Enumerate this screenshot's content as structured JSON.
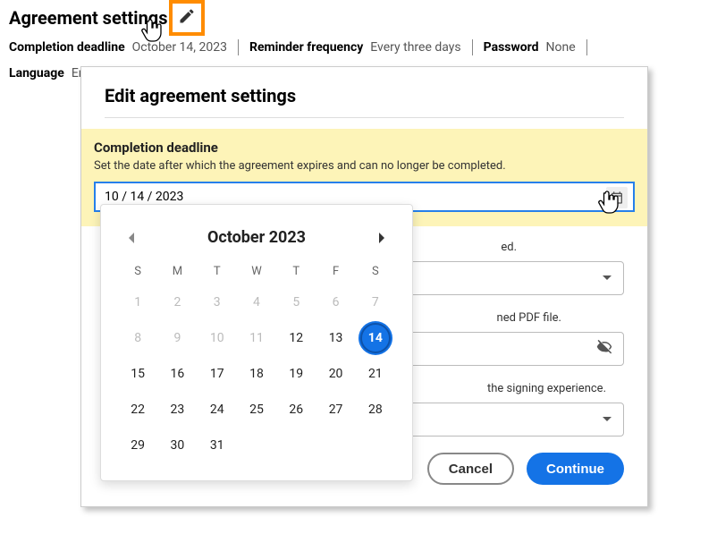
{
  "header": {
    "title": "Agreement settings",
    "summary": {
      "completion_deadline_label": "Completion deadline",
      "completion_deadline_value": "October 14, 2023",
      "reminder_label": "Reminder frequency",
      "reminder_value": "Every three days",
      "password_label": "Password",
      "password_value": "None",
      "language_label": "Language",
      "language_value": "English/UK"
    }
  },
  "modal": {
    "title": "Edit agreement settings",
    "deadline": {
      "label": "Completion deadline",
      "desc": "Set the date after which the agreement expires and can no longer be completed.",
      "value": "10 / 14 / 2023"
    },
    "reminder_desc_partial": "ed.",
    "password_desc_partial": "ned PDF file.",
    "language_desc_partial": "the signing experience.",
    "buttons": {
      "cancel": "Cancel",
      "continue": "Continue"
    }
  },
  "calendar": {
    "month_label": "October 2023",
    "dow": [
      "S",
      "M",
      "T",
      "W",
      "T",
      "F",
      "S"
    ],
    "weeks": [
      [
        {
          "n": 1,
          "d": true
        },
        {
          "n": 2,
          "d": true
        },
        {
          "n": 3,
          "d": true
        },
        {
          "n": 4,
          "d": true
        },
        {
          "n": 5,
          "d": true
        },
        {
          "n": 6,
          "d": true
        },
        {
          "n": 7,
          "d": true
        }
      ],
      [
        {
          "n": 8,
          "d": true
        },
        {
          "n": 9,
          "d": true
        },
        {
          "n": 10,
          "d": true
        },
        {
          "n": 11,
          "d": true
        },
        {
          "n": 12,
          "d": false
        },
        {
          "n": 13,
          "d": false
        },
        {
          "n": 14,
          "d": false,
          "sel": true
        }
      ],
      [
        {
          "n": 15,
          "d": false
        },
        {
          "n": 16,
          "d": false
        },
        {
          "n": 17,
          "d": false
        },
        {
          "n": 18,
          "d": false
        },
        {
          "n": 19,
          "d": false
        },
        {
          "n": 20,
          "d": false
        },
        {
          "n": 21,
          "d": false
        }
      ],
      [
        {
          "n": 22,
          "d": false
        },
        {
          "n": 23,
          "d": false
        },
        {
          "n": 24,
          "d": false
        },
        {
          "n": 25,
          "d": false
        },
        {
          "n": 26,
          "d": false
        },
        {
          "n": 27,
          "d": false
        },
        {
          "n": 28,
          "d": false
        }
      ],
      [
        {
          "n": 29,
          "d": false
        },
        {
          "n": 30,
          "d": false
        },
        {
          "n": 31,
          "d": false
        },
        null,
        null,
        null,
        null
      ]
    ]
  }
}
